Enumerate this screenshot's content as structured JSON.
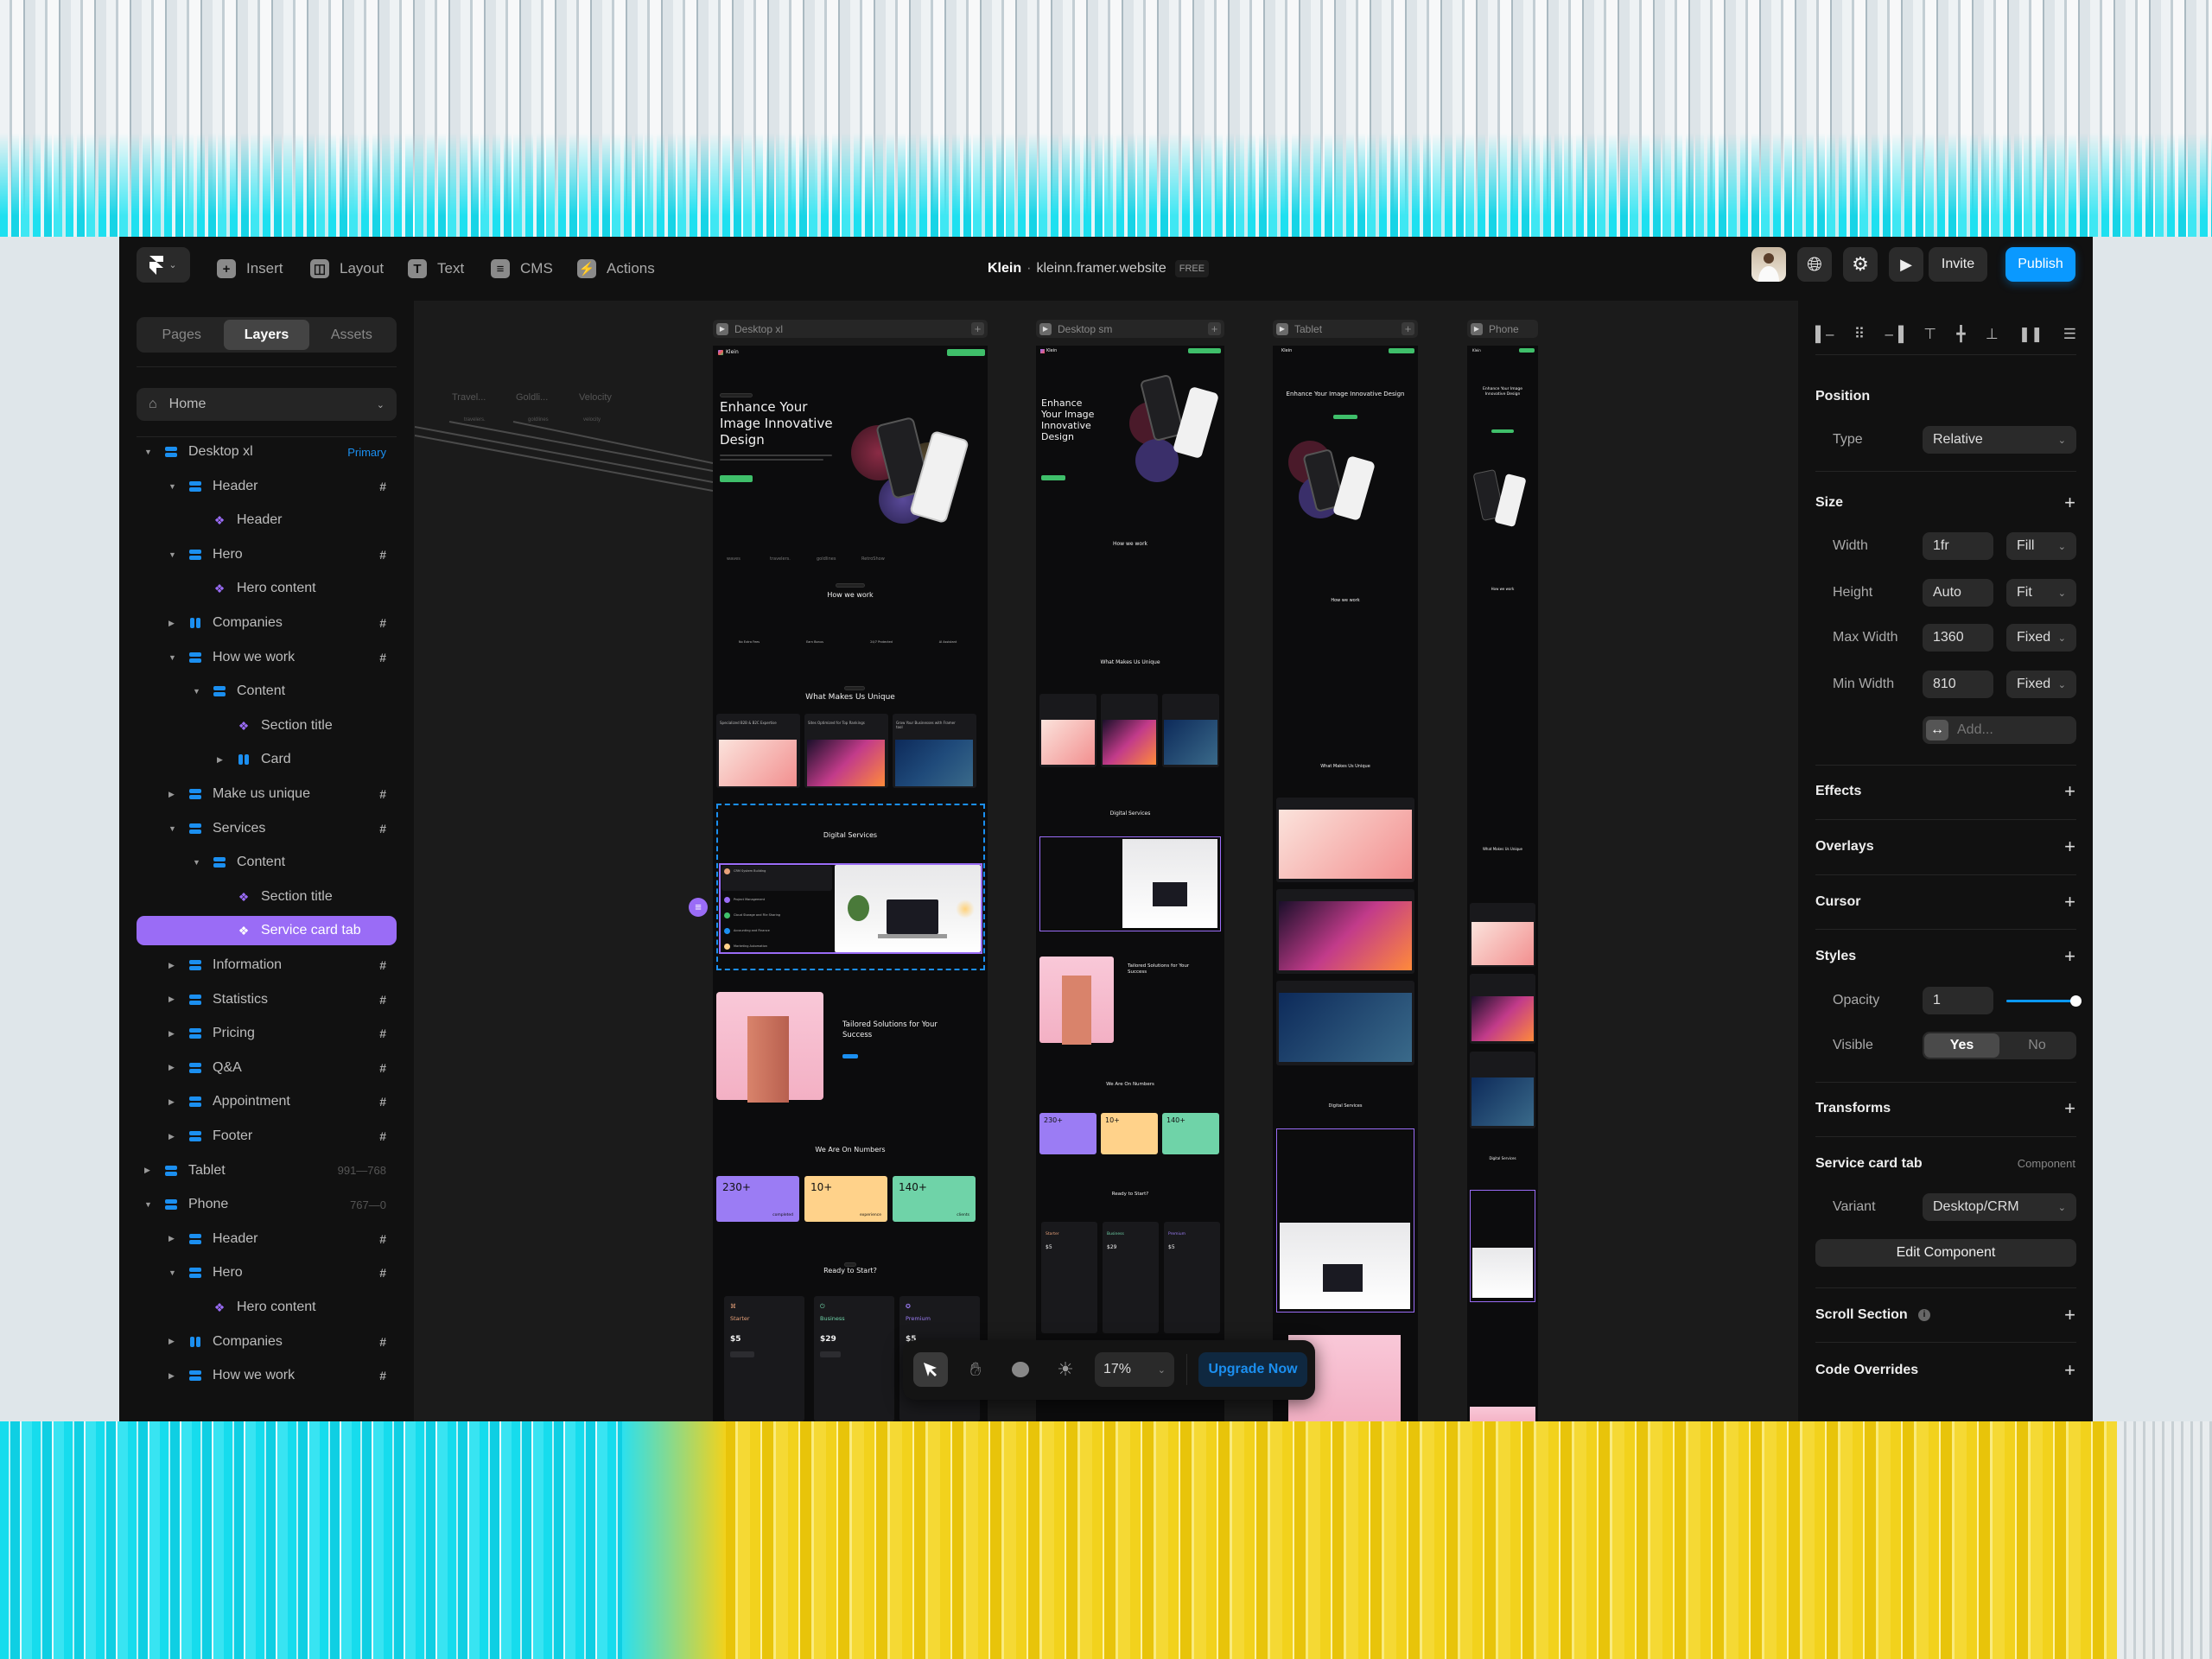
{
  "topbar": {
    "menus": [
      {
        "label": "Insert",
        "icon": "plus-icon"
      },
      {
        "label": "Layout",
        "icon": "layout-icon"
      },
      {
        "label": "Text",
        "icon": "text-icon"
      },
      {
        "label": "CMS",
        "icon": "database-icon"
      },
      {
        "label": "Actions",
        "icon": "bolt-icon"
      }
    ],
    "project": "Klein",
    "separator": "·",
    "domain": "kleinn.framer.website",
    "plan_badge": "FREE",
    "invite": "Invite",
    "publish": "Publish"
  },
  "left_panel": {
    "tabs": [
      "Pages",
      "Layers",
      "Assets"
    ],
    "active_tab": "Layers",
    "page_select": "Home",
    "layers": [
      {
        "label": "Desktop xl",
        "level": 0,
        "icon": "stack",
        "toggle": "open",
        "tag": "Primary"
      },
      {
        "label": "Header",
        "level": 1,
        "icon": "stack",
        "toggle": "open",
        "tag": "#"
      },
      {
        "label": "Header",
        "level": 2,
        "icon": "comp",
        "toggle": "none",
        "tag": ""
      },
      {
        "label": "Hero",
        "level": 1,
        "icon": "stack",
        "toggle": "open",
        "tag": "#"
      },
      {
        "label": "Hero content",
        "level": 2,
        "icon": "comp",
        "toggle": "none",
        "tag": ""
      },
      {
        "label": "Companies",
        "level": 1,
        "icon": "grid",
        "toggle": "closed",
        "tag": "#"
      },
      {
        "label": "How we work",
        "level": 1,
        "icon": "stack",
        "toggle": "open",
        "tag": "#"
      },
      {
        "label": "Content",
        "level": 2,
        "icon": "stack",
        "toggle": "open",
        "tag": ""
      },
      {
        "label": "Section title",
        "level": 3,
        "icon": "comp",
        "toggle": "none",
        "tag": ""
      },
      {
        "label": "Card",
        "level": 3,
        "icon": "grid",
        "toggle": "closed",
        "tag": ""
      },
      {
        "label": "Make us unique",
        "level": 1,
        "icon": "stack",
        "toggle": "closed",
        "tag": "#"
      },
      {
        "label": "Services",
        "level": 1,
        "icon": "stack",
        "toggle": "open",
        "tag": "#"
      },
      {
        "label": "Content",
        "level": 2,
        "icon": "stack",
        "toggle": "open",
        "tag": ""
      },
      {
        "label": "Section title",
        "level": 3,
        "icon": "comp",
        "toggle": "none",
        "tag": ""
      },
      {
        "label": "Service card tab",
        "level": 3,
        "icon": "comp",
        "toggle": "none",
        "tag": "",
        "selected": true
      },
      {
        "label": "Information",
        "level": 1,
        "icon": "stack",
        "toggle": "closed",
        "tag": "#"
      },
      {
        "label": "Statistics",
        "level": 1,
        "icon": "stack",
        "toggle": "closed",
        "tag": "#"
      },
      {
        "label": "Pricing",
        "level": 1,
        "icon": "stack",
        "toggle": "closed",
        "tag": "#"
      },
      {
        "label": "Q&A",
        "level": 1,
        "icon": "stack",
        "toggle": "closed",
        "tag": "#"
      },
      {
        "label": "Appointment",
        "level": 1,
        "icon": "stack",
        "toggle": "closed",
        "tag": "#"
      },
      {
        "label": "Footer",
        "level": 1,
        "icon": "stack",
        "toggle": "closed",
        "tag": "#"
      },
      {
        "label": "Tablet",
        "level": 0,
        "icon": "stack",
        "toggle": "closed",
        "tag": "991—768"
      },
      {
        "label": "Phone",
        "level": 0,
        "icon": "stack",
        "toggle": "open",
        "tag": "767—0"
      },
      {
        "label": "Header",
        "level": 1,
        "icon": "stack",
        "toggle": "closed",
        "tag": "#"
      },
      {
        "label": "Hero",
        "level": 1,
        "icon": "stack",
        "toggle": "open",
        "tag": "#"
      },
      {
        "label": "Hero content",
        "level": 2,
        "icon": "comp",
        "toggle": "none",
        "tag": ""
      },
      {
        "label": "Companies",
        "level": 1,
        "icon": "grid",
        "toggle": "closed",
        "tag": "#"
      },
      {
        "label": "How we work",
        "level": 1,
        "icon": "stack",
        "toggle": "closed",
        "tag": "#"
      }
    ]
  },
  "canvas": {
    "frames": [
      "Desktop xl",
      "Desktop sm",
      "Tablet",
      "Phone"
    ],
    "offscreen_labels": [
      "Travel...",
      "Goldli...",
      "Velocity"
    ],
    "offscreen_logos": [
      "travelers.",
      "goldlines",
      "velocity"
    ],
    "site": {
      "brand": "Klein",
      "hero_title": "Enhance Your Image Innovative Design",
      "logos": [
        "waves",
        "travelers.",
        "goldlines",
        "RetroShow"
      ],
      "how_title": "How we work",
      "features": [
        "No Extra Fees",
        "Earn Bonus",
        "24/7 Protected",
        "AI Assistant"
      ],
      "unique_title": "What Makes Us Unique",
      "unique_cards": [
        "Specialized B2B & B2C Expertise",
        "Sites Optimized for Top Rankings",
        "Grow Your Businesses with Framer tool"
      ],
      "services_title": "Digital Services",
      "services": [
        "CRM System Building",
        "Project Management",
        "Cloud Storage and File Sharing",
        "Accounting and Finance",
        "Marketing Automation"
      ],
      "tailored_title": "Tailored Solutions for Your Success",
      "numbers_title": "We Are On Numbers",
      "stats": [
        {
          "value": "230+",
          "label": "completed",
          "color": "#9b7cf4"
        },
        {
          "value": "10+",
          "label": "experience",
          "color": "#ffd28a"
        },
        {
          "value": "140+",
          "label": "clients",
          "color": "#6fd3a8"
        }
      ],
      "pricing_title": "Ready to Start?",
      "plans": [
        {
          "name": "Starter",
          "price": "$5",
          "color": "#e8a27a"
        },
        {
          "name": "Business",
          "price": "$29",
          "color": "#6fd3a8"
        },
        {
          "name": "Premium",
          "price": "$5",
          "color": "#9b7cf4"
        }
      ]
    },
    "toolbar": {
      "zoom": "17%",
      "upgrade": "Upgrade Now",
      "tools": [
        "pointer-icon",
        "hand-icon",
        "comment-icon",
        "sun-icon"
      ]
    }
  },
  "right_panel": {
    "align_icons": [
      "align-left",
      "align-center-h",
      "align-right",
      "align-top",
      "align-center-v",
      "align-bottom",
      "distribute-h",
      "distribute-v"
    ],
    "position": {
      "title": "Position",
      "type_label": "Type",
      "type_value": "Relative"
    },
    "size": {
      "title": "Size",
      "width_label": "Width",
      "width_value": "1fr",
      "width_mode": "Fill",
      "height_label": "Height",
      "height_value": "Auto",
      "height_mode": "Fit",
      "max_label": "Max Width",
      "max_value": "1360",
      "max_mode": "Fixed",
      "min_label": "Min Width",
      "min_value": "810",
      "min_mode": "Fixed",
      "add_placeholder": "Add..."
    },
    "effects": "Effects",
    "overlays": "Overlays",
    "cursor": "Cursor",
    "styles": {
      "title": "Styles",
      "opacity_label": "Opacity",
      "opacity_value": "1",
      "opacity_fraction": 1,
      "visible_label": "Visible",
      "yes": "Yes",
      "no": "No",
      "visible": "Yes"
    },
    "transforms": "Transforms",
    "component": {
      "title": "Service card tab",
      "kind": "Component",
      "variant_label": "Variant",
      "variant_value": "Desktop/CRM",
      "edit": "Edit Component"
    },
    "scroll_section": "Scroll Section",
    "code_overrides": "Code Overrides",
    "accent": "#0a99ff",
    "selection": "#9a6cf6"
  }
}
